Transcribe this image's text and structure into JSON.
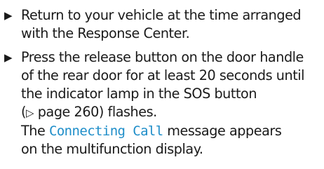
{
  "bullet_glyph": "▶",
  "steps": [
    {
      "lines": [
        "Return to your vehicle at the time arranged",
        "with the Response Center."
      ]
    },
    {
      "lines": [
        "Press the release button on the door handle",
        "of the rear door for at least 20 seconds until",
        "the indicator lamp in the SOS button"
      ],
      "page_ref": {
        "open": "(",
        "glyph": "▷",
        "text": " page 260) flashes."
      },
      "message": {
        "prefix": "The ",
        "name": "Connecting Call",
        "suffix": " message appears"
      },
      "last_line": "on the multifunction display."
    }
  ],
  "colors": {
    "text": "#1a1a1a",
    "display_message": "#1f8ec9"
  }
}
